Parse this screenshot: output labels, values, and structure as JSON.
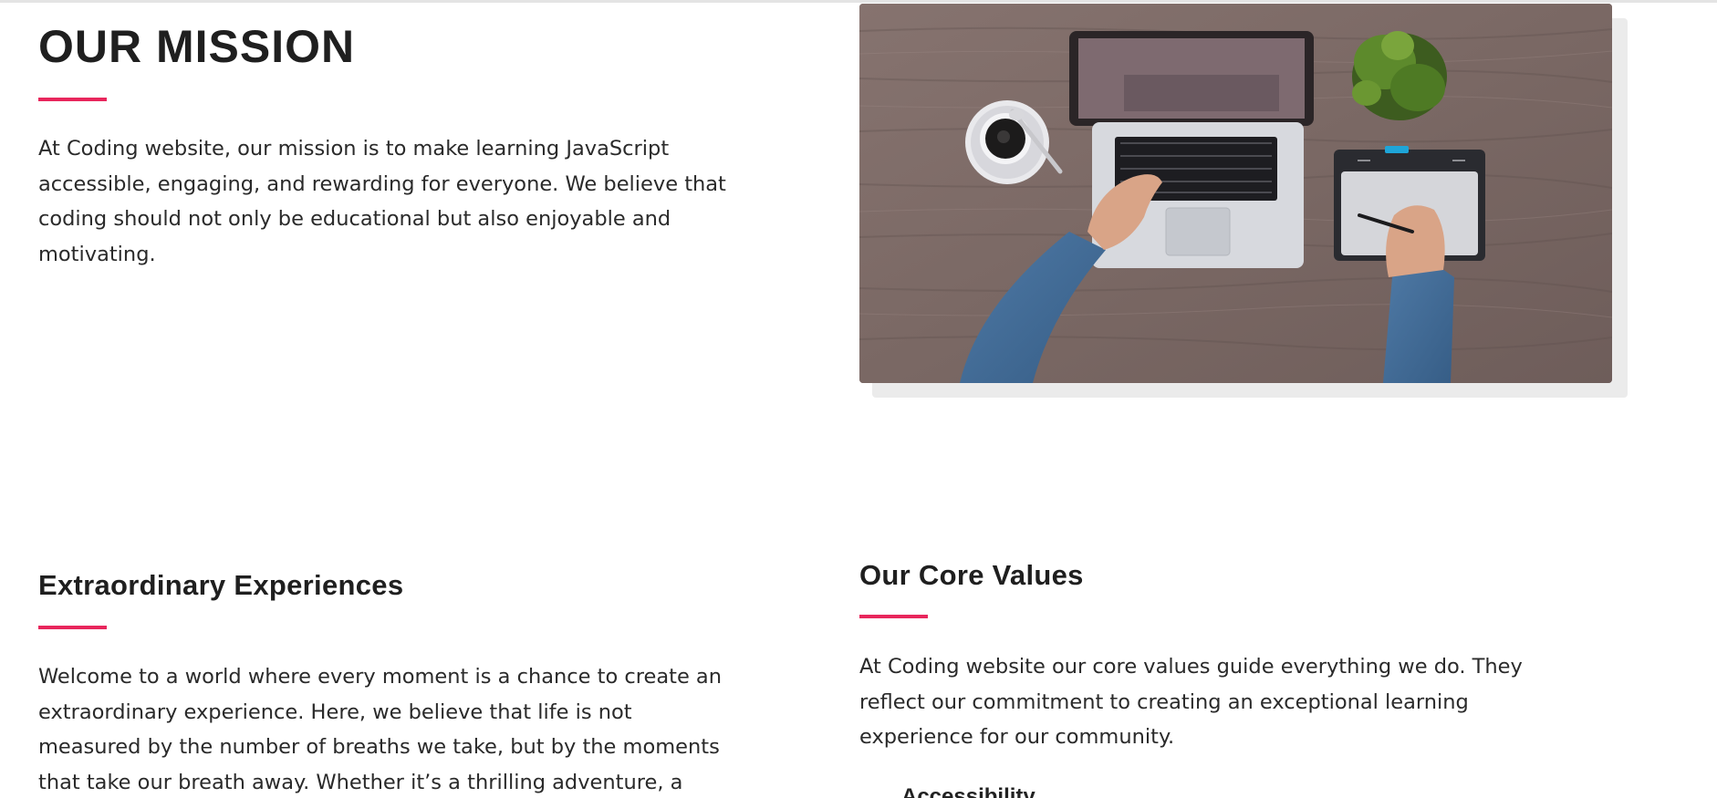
{
  "mission": {
    "heading": "OUR MISSION",
    "text": "At Coding website, our mission is to make learning JavaScript accessible, engaging, and rewarding for everyone. We believe that coding should not only be educational but also enjoyable and motivating.",
    "image": {
      "subject": "desk-with-laptop-coffee-plant-tablet"
    }
  },
  "experiences": {
    "heading": "Extraordinary Experiences",
    "text": "Welcome to a world where every moment is a chance to create an extraordinary experience. Here, we believe that life is not measured by the number of breaths we take, but by the moments that take our breath away. Whether it’s a thrilling adventure, a"
  },
  "core_values": {
    "heading": "Our Core Values",
    "text": "At Coding website our core values guide everything we do. They reflect our commitment to creating an exceptional learning experience for our community.",
    "items": [
      {
        "label": "Accessibility"
      }
    ]
  },
  "colors": {
    "accent": "#e8265c",
    "heading": "#1f1f1f",
    "body_text": "#2a2a2a",
    "background": "#ffffff"
  }
}
